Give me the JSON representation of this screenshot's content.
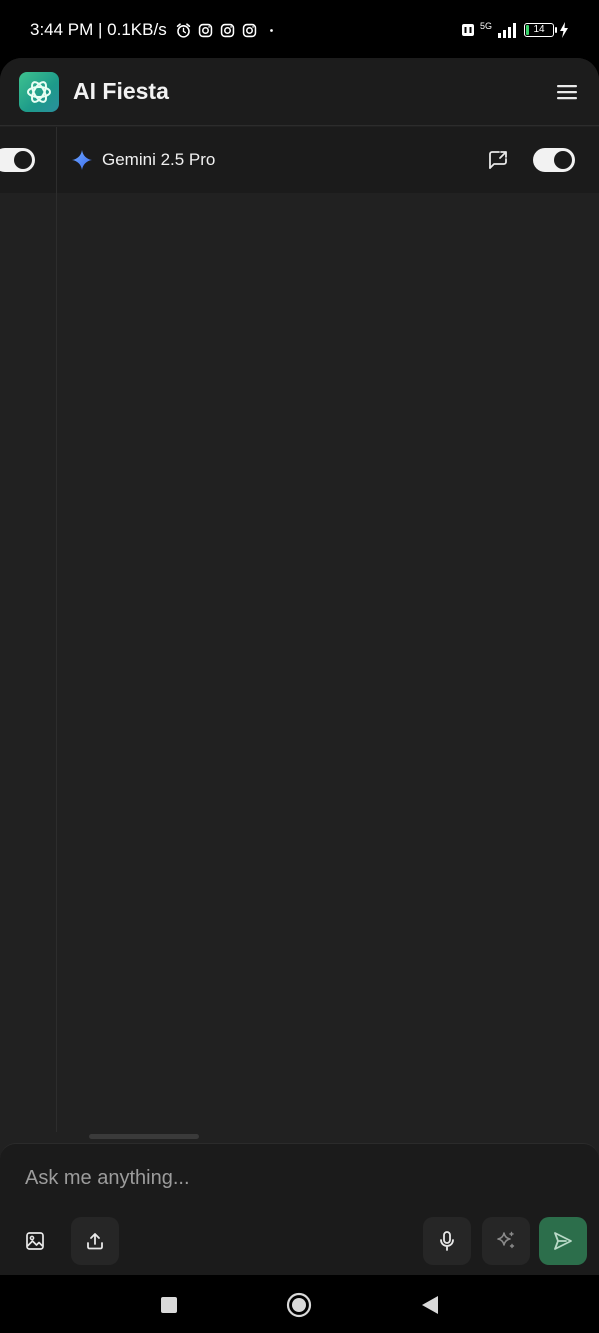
{
  "status_bar": {
    "time_text": "3:44 PM | 0.1KB/s",
    "network": "5G",
    "battery": "14"
  },
  "header": {
    "app_title": "AI Fiesta"
  },
  "model_bar": {
    "model_name": "Gemini 2.5 Pro"
  },
  "composer": {
    "placeholder": "Ask me anything..."
  },
  "colors": {
    "background": "#212121",
    "accent": "#2c6e4b",
    "logo": "#3ec28f",
    "gemini_star": "#4a8cff"
  },
  "icons": {
    "menu": "hamburger-icon",
    "gemini": "gemini-star-icon",
    "share": "share-icon",
    "image": "image-icon",
    "upload": "upload-icon",
    "mic": "microphone-icon",
    "enhance": "sparkle-icon",
    "send": "send-icon"
  }
}
